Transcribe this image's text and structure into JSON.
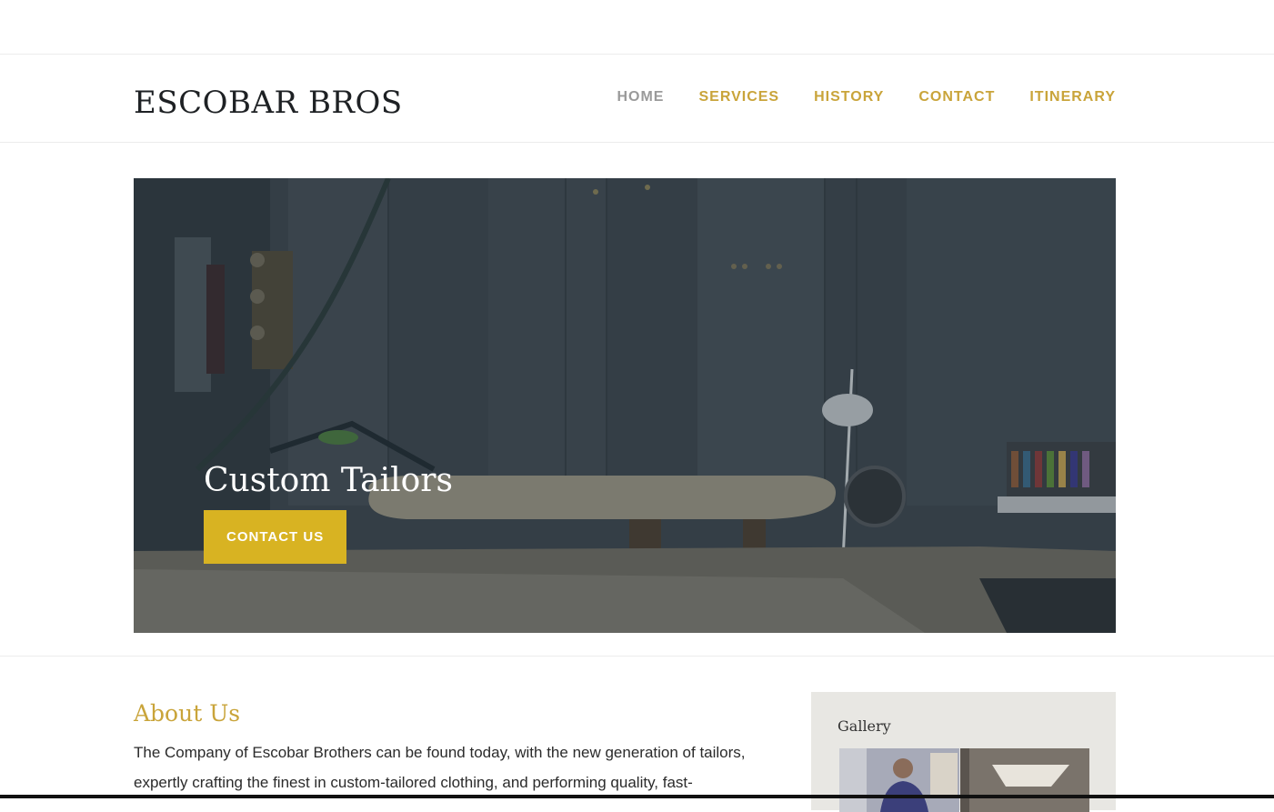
{
  "brand": {
    "logo_text": "ESCOBAR BROS"
  },
  "nav": {
    "items": [
      {
        "label": "HOME",
        "active": true
      },
      {
        "label": "SERVICES",
        "active": false
      },
      {
        "label": "HISTORY",
        "active": false
      },
      {
        "label": "CONTACT",
        "active": false
      },
      {
        "label": "ITINERARY",
        "active": false
      }
    ]
  },
  "hero": {
    "title": "Custom Tailors",
    "button_label": "CONTACT US"
  },
  "about": {
    "heading": "About Us",
    "body": "The Company of Escobar Brothers can be found today, with the new generation of tailors, expertly crafting the finest in custom-tailored clothing, and performing quality, fast-"
  },
  "gallery": {
    "heading": "Gallery"
  },
  "colors": {
    "accent": "#c9a43a",
    "button": "#d8b322",
    "nav_active": "#9a9a9a",
    "gallery_bg": "#e8e7e3"
  }
}
